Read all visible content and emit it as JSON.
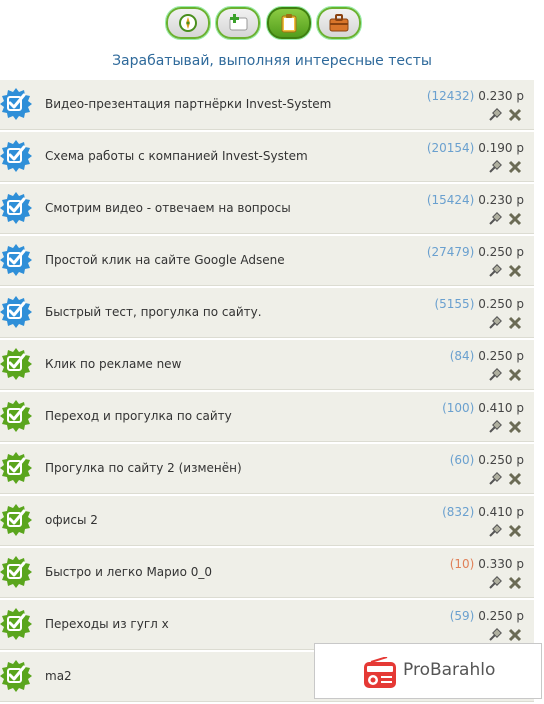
{
  "nav": {
    "buttons": [
      {
        "icon": "compass-icon",
        "active": false
      },
      {
        "icon": "add-page-icon",
        "active": false
      },
      {
        "icon": "clipboard-icon",
        "active": true
      },
      {
        "icon": "briefcase-icon",
        "active": false
      }
    ]
  },
  "heading": "Зарабатывай, выполняя интересные тесты",
  "tasks": [
    {
      "title": "Видео-презентация партнёрки Invest-System",
      "count": "(12432)",
      "price": "0.230 р",
      "badge": "blue"
    },
    {
      "title": "Схема работы с компанией Invest-System",
      "count": "(20154)",
      "price": "0.190 р",
      "badge": "blue"
    },
    {
      "title": "Смотрим видео - отвечаем на вопросы",
      "count": "(15424)",
      "price": "0.230 р",
      "badge": "blue"
    },
    {
      "title": "Простой клик на сайте Google Adsene",
      "count": "(27479)",
      "price": "0.250 р",
      "badge": "blue"
    },
    {
      "title": "Быстрый тест, прогулка по сайту.",
      "count": "(5155)",
      "price": "0.250 р",
      "badge": "blue"
    },
    {
      "title": "Клик по рекламе new",
      "count": "(84)",
      "price": "0.250 р",
      "badge": "green"
    },
    {
      "title": "Переход и прогулка по сайту",
      "count": "(100)",
      "price": "0.410 р",
      "badge": "green"
    },
    {
      "title": "Прогулка по сайту 2 (изменён)",
      "count": "(60)",
      "price": "0.250 р",
      "badge": "green"
    },
    {
      "title": "офисы 2",
      "count": "(832)",
      "price": "0.410 р",
      "badge": "green"
    },
    {
      "title": "Быстро и легко Марио 0_0",
      "count": "(10)",
      "price": "0.330 р",
      "badge": "green",
      "warn": true
    },
    {
      "title": "Переходы из гугл х",
      "count": "(59)",
      "price": "0.250 р",
      "badge": "green"
    },
    {
      "title": "ma2",
      "count": "",
      "price": "",
      "badge": "green"
    }
  ],
  "colors": {
    "badge_blue": "#2f8fd8",
    "badge_green": "#5aa51d",
    "heading": "#2f6a9b",
    "row_bg": "#efefe8",
    "count": "#6aa0cf",
    "count_warn": "#e08058"
  },
  "watermark": {
    "brand": "ProBarahlo"
  }
}
